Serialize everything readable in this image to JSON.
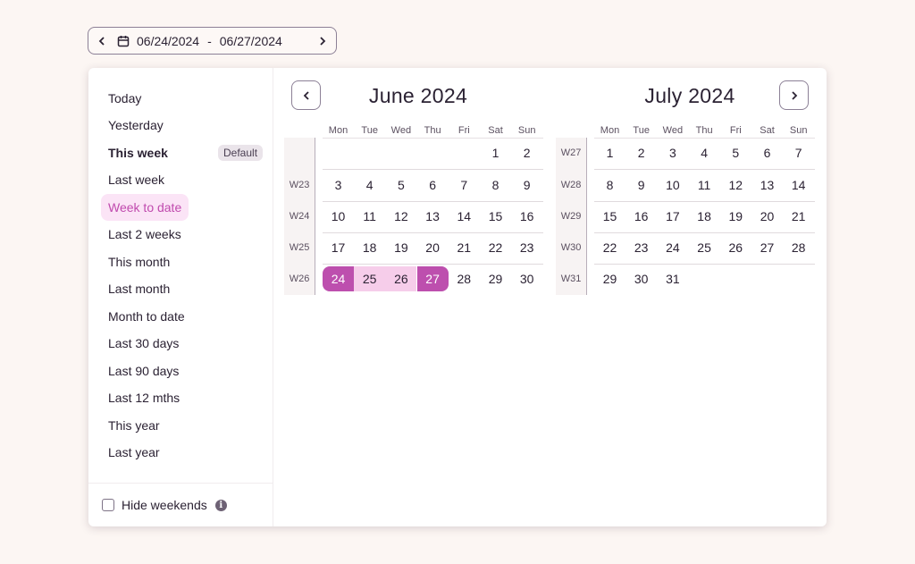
{
  "trigger": {
    "start_date": "06/24/2024",
    "separator": "-",
    "end_date": "06/27/2024"
  },
  "presets": [
    {
      "label": "Today"
    },
    {
      "label": "Yesterday"
    },
    {
      "label": "This week",
      "badge": "Default"
    },
    {
      "label": "Last week"
    },
    {
      "label": "Week to date",
      "selected": true
    },
    {
      "label": "Last 2 weeks"
    },
    {
      "label": "This month"
    },
    {
      "label": "Last month"
    },
    {
      "label": "Month to date"
    },
    {
      "label": "Last 30 days"
    },
    {
      "label": "Last 90 days"
    },
    {
      "label": "Last 12 mths"
    },
    {
      "label": "This year"
    },
    {
      "label": "Last year"
    }
  ],
  "footer": {
    "hide_weekends_label": "Hide weekends",
    "hide_weekends_checked": false,
    "info_icon": "i"
  },
  "weekday_headers": [
    "Mon",
    "Tue",
    "Wed",
    "Thu",
    "Fri",
    "Sat",
    "Sun"
  ],
  "months": [
    {
      "title": "June 2024",
      "weeks": [
        {
          "label": "",
          "days": [
            "",
            "",
            "",
            "",
            "",
            "1",
            "2"
          ]
        },
        {
          "label": "W23",
          "days": [
            "3",
            "4",
            "5",
            "6",
            "7",
            "8",
            "9"
          ]
        },
        {
          "label": "W24",
          "days": [
            "10",
            "11",
            "12",
            "13",
            "14",
            "15",
            "16"
          ]
        },
        {
          "label": "W25",
          "days": [
            "17",
            "18",
            "19",
            "20",
            "21",
            "22",
            "23"
          ]
        },
        {
          "label": "W26",
          "days": [
            "24",
            "25",
            "26",
            "27",
            "28",
            "29",
            "30"
          ]
        }
      ]
    },
    {
      "title": "July 2024",
      "weeks": [
        {
          "label": "W27",
          "days": [
            "1",
            "2",
            "3",
            "4",
            "5",
            "6",
            "7"
          ]
        },
        {
          "label": "W28",
          "days": [
            "8",
            "9",
            "10",
            "11",
            "12",
            "13",
            "14"
          ]
        },
        {
          "label": "W29",
          "days": [
            "15",
            "16",
            "17",
            "18",
            "19",
            "20",
            "21"
          ]
        },
        {
          "label": "W30",
          "days": [
            "22",
            "23",
            "24",
            "25",
            "26",
            "27",
            "28"
          ]
        },
        {
          "label": "W31",
          "days": [
            "29",
            "30",
            "31",
            "",
            "",
            "",
            ""
          ]
        }
      ]
    }
  ],
  "selection": {
    "month": "June 2024",
    "start_day": "24",
    "end_day": "27"
  },
  "colors": {
    "accent": "#bd4fae",
    "range_fill": "#f6cdea",
    "preset_selected_bg": "#fbe4f6",
    "background": "#fcf6f3"
  }
}
